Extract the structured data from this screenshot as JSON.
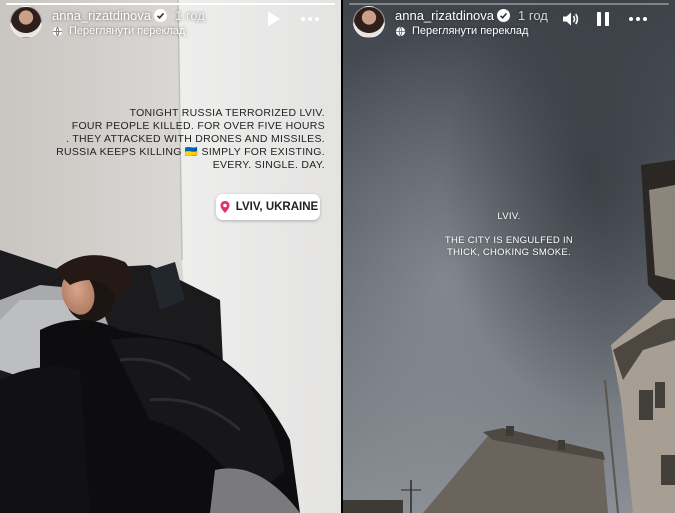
{
  "stories": [
    {
      "username": "anna_rizatdinova",
      "time": "1 год",
      "translate_label": "Переглянути переклад",
      "progress": 1.0,
      "text_lines": [
        "TONIGHT RUSSIA TERRORIZED LVIV.",
        "FOUR PEOPLE KILLED. FOR OVER FIVE HOURS",
        ". THEY ATTACKED WITH DRONES AND MISSILES.",
        "RUSSIA KEEPS KILLING 🇺🇦 SIMPLY FOR EXISTING.",
        "EVERY. SINGLE. DAY."
      ],
      "location": "LVIV, UKRAINE",
      "controls": [
        "play-icon",
        "more-icon"
      ]
    },
    {
      "username": "anna_rizatdinova",
      "time": "1 год",
      "translate_label": "Переглянути переклад",
      "progress": 0.0,
      "text_lines": [
        "LVIV.",
        "",
        "THE CITY IS ENGULFED IN",
        "THICK, CHOKING SMOKE."
      ],
      "controls": [
        "volume-icon",
        "pause-icon",
        "more-icon"
      ]
    }
  ],
  "colors": {
    "story_text_dark": "#222222",
    "story_text_light": "#ffffff",
    "sticker_bg": "#ffffff",
    "location_pin": "#e1306c"
  }
}
